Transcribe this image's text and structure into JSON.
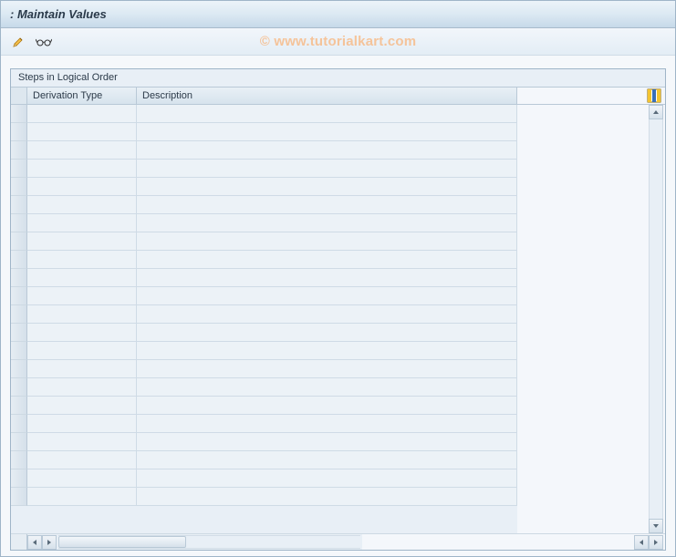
{
  "title": ": Maintain Values",
  "watermark": "© www.tutorialkart.com",
  "panel": {
    "title": "Steps in Logical Order",
    "columns": {
      "derivation": "Derivation Type",
      "description": "Description"
    },
    "rows": [
      {
        "derivation": "",
        "description": ""
      },
      {
        "derivation": "",
        "description": ""
      },
      {
        "derivation": "",
        "description": ""
      },
      {
        "derivation": "",
        "description": ""
      },
      {
        "derivation": "",
        "description": ""
      },
      {
        "derivation": "",
        "description": ""
      },
      {
        "derivation": "",
        "description": ""
      },
      {
        "derivation": "",
        "description": ""
      },
      {
        "derivation": "",
        "description": ""
      },
      {
        "derivation": "",
        "description": ""
      },
      {
        "derivation": "",
        "description": ""
      },
      {
        "derivation": "",
        "description": ""
      },
      {
        "derivation": "",
        "description": ""
      },
      {
        "derivation": "",
        "description": ""
      },
      {
        "derivation": "",
        "description": ""
      },
      {
        "derivation": "",
        "description": ""
      },
      {
        "derivation": "",
        "description": ""
      },
      {
        "derivation": "",
        "description": ""
      },
      {
        "derivation": "",
        "description": ""
      },
      {
        "derivation": "",
        "description": ""
      },
      {
        "derivation": "",
        "description": ""
      },
      {
        "derivation": "",
        "description": ""
      }
    ]
  }
}
